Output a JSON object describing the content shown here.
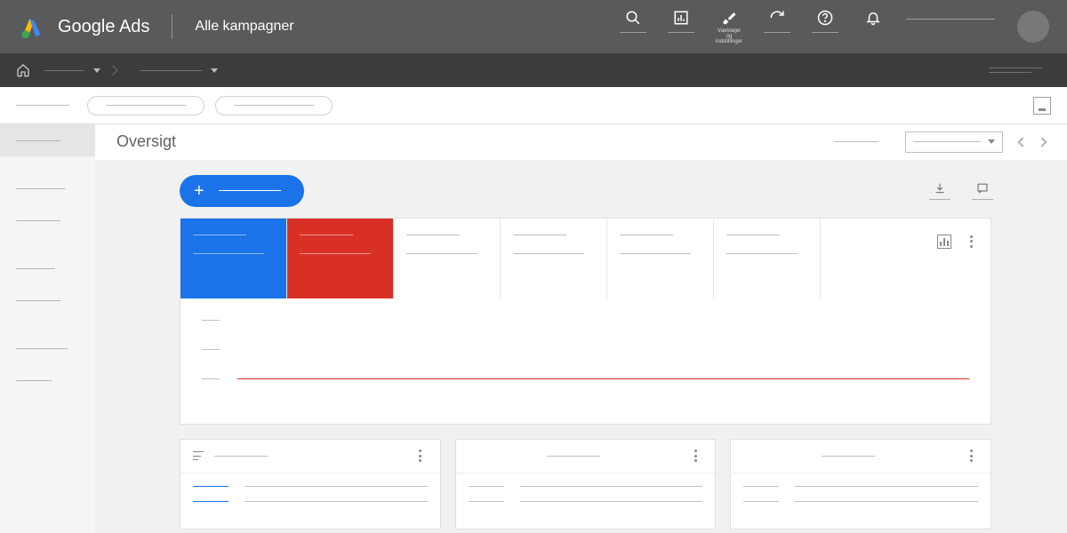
{
  "app": {
    "name": "Google Ads",
    "context": "Alle kampagner"
  },
  "top_icons": {
    "tools_label": "Værktøjer og indstillinger"
  },
  "page": {
    "title": "Oversigt"
  },
  "colors": {
    "blue": "#1a73e8",
    "red": "#d93025"
  }
}
